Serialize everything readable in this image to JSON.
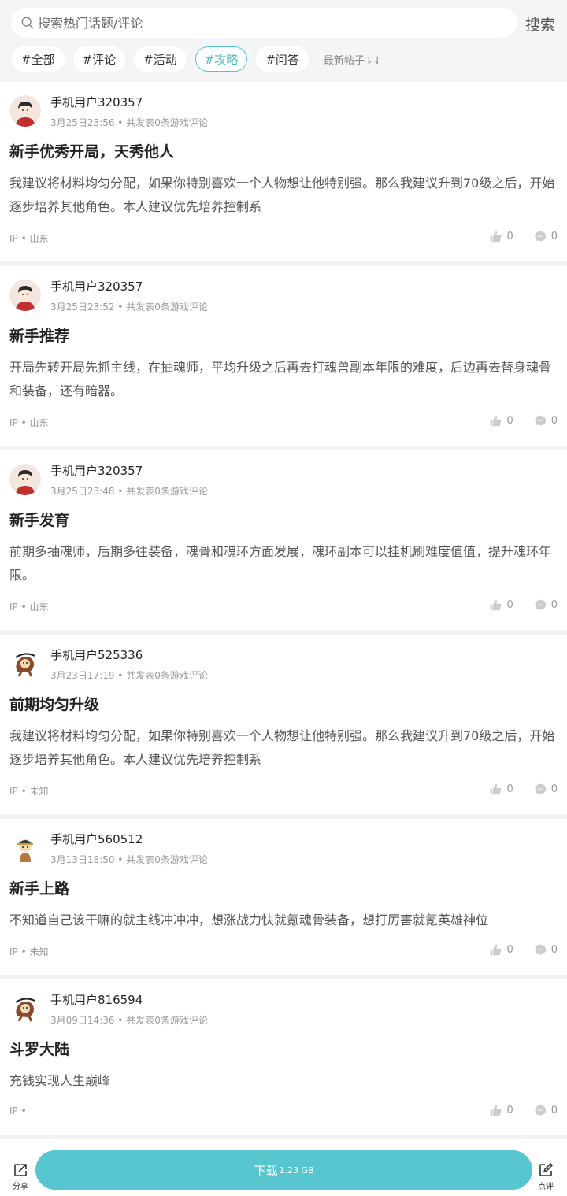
{
  "search": {
    "placeholder": "搜索热门话题/评论",
    "button_label": "搜索"
  },
  "tags": [
    {
      "label": "#全部",
      "active": false
    },
    {
      "label": "#评论",
      "active": false
    },
    {
      "label": "#活动",
      "active": false
    },
    {
      "label": "#攻略",
      "active": true
    },
    {
      "label": "#问答",
      "active": false
    }
  ],
  "sort_label": "最新帖子⇂⇃",
  "accent_color": "#58c6ce",
  "posts": [
    {
      "avatar": "boy-avatar-icon",
      "username": "手机用户320357",
      "meta": "3月25日23:56 • 共发表0条游戏评论",
      "title": "新手优秀开局，天秀他人",
      "content": "我建议将材料均匀分配，如果你特别喜欢一个人物想让他特别强。那么我建议升到70级之后，开始逐步培养其他角色。本人建议优先培养控制系",
      "ip": "IP • 山东",
      "likes": "0",
      "comments": "0"
    },
    {
      "avatar": "boy-avatar-icon",
      "username": "手机用户320357",
      "meta": "3月25日23:52 • 共发表0条游戏评论",
      "title": "新手推荐",
      "content": "开局先转开局先抓主线，在抽魂师，平均升级之后再去打魂兽副本年限的难度，后边再去替身魂骨和装备，还有暗器。",
      "ip": "IP • 山东",
      "likes": "0",
      "comments": "0"
    },
    {
      "avatar": "boy-avatar-icon",
      "username": "手机用户320357",
      "meta": "3月25日23:48 • 共发表0条游戏评论",
      "title": "新手发育",
      "content": "前期多抽魂师，后期多往装备，魂骨和魂环方面发展，魂环副本可以挂机刷难度值值，提升魂环年限。",
      "ip": "IP • 山东",
      "likes": "0",
      "comments": "0"
    },
    {
      "avatar": "monkey-avatar-icon",
      "username": "手机用户525336",
      "meta": "3月23日17:19 • 共发表0条游戏评论",
      "title": "前期均匀升级",
      "content": "我建议将材料均匀分配，如果你特别喜欢一个人物想让他特别强。那么我建议升到70级之后，开始逐步培养其他角色。本人建议优先培养控制系",
      "ip": "IP • 未知",
      "likes": "0",
      "comments": "0"
    },
    {
      "avatar": "ninja-avatar-icon",
      "username": "手机用户560512",
      "meta": "3月13日18:50 • 共发表0条游戏评论",
      "title": "新手上路",
      "content": "不知道自己该干嘛的就主线冲冲冲，想涨战力快就氪魂骨装备，想打厉害就氪英雄神位",
      "ip": "IP • 未知",
      "likes": "0",
      "comments": "0"
    },
    {
      "avatar": "monkey-avatar-icon",
      "username": "手机用户816594",
      "meta": "3月09日14:36 • 共发表0条游戏评论",
      "title": "斗罗大陆",
      "content": "充钱实现人生巅峰",
      "ip": "IP •",
      "likes": "0",
      "comments": "0"
    }
  ],
  "bottom": {
    "share_label": "分享",
    "download_label": "下载",
    "download_size": "1.23 GB",
    "review_label": "点评"
  }
}
